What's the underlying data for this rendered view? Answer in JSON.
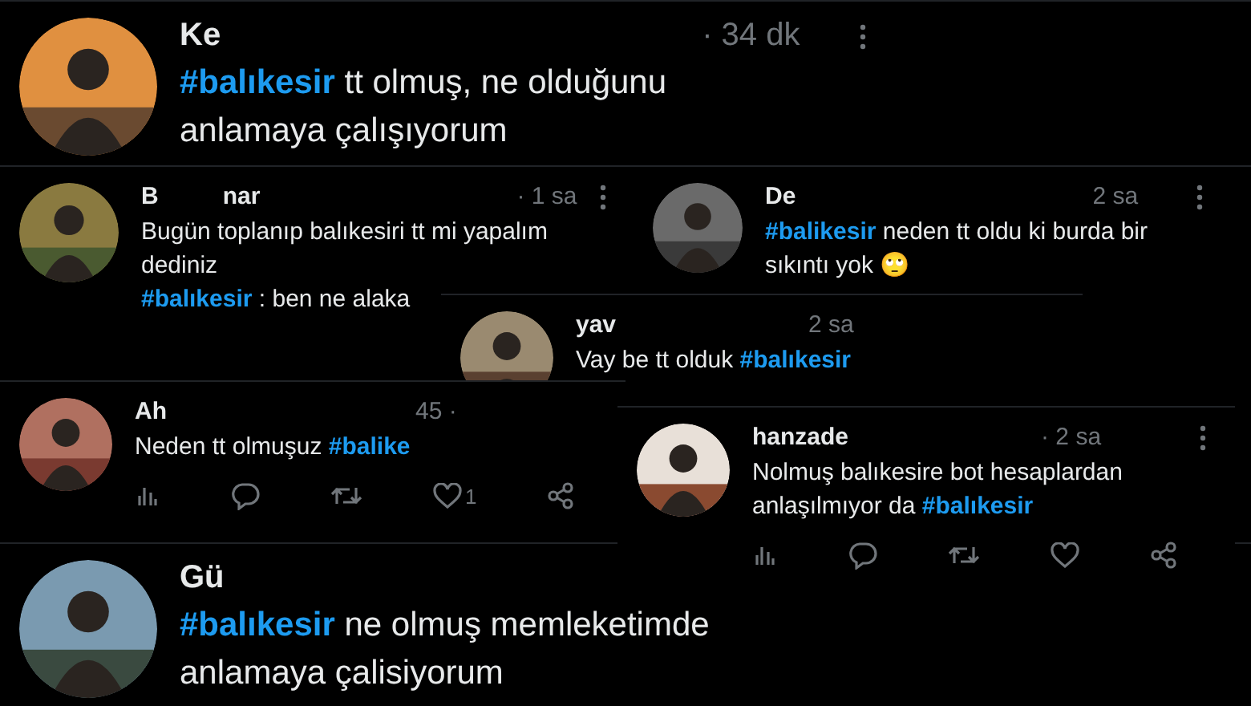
{
  "tweets": [
    {
      "name": "Ke",
      "time": "· 34 dk",
      "text": [
        "**#balıkesir** tt olmuş, ne olduğunu",
        "anlamaya çalışıyorum"
      ]
    },
    {
      "name": "B",
      "name_tail": "nar",
      "time": "· 1 sa",
      "text": [
        "Bugün toplanıp balıkesiri tt mi yapalım",
        "dediniz",
        "**#balıkesir** : ben ne alaka"
      ]
    },
    {
      "name": "De",
      "time": "2 sa",
      "text": [
        "**#balikesir** neden tt oldu ki burda bir",
        "sıkıntı yok 🙄"
      ]
    },
    {
      "name": "yav",
      "time": "2 sa",
      "text": [
        "Vay be tt olduk **#balıkesir**"
      ]
    },
    {
      "name": "Ah",
      "time": "45 ·",
      "text": [
        "Neden tt olmuşuz **#balike**"
      ],
      "actions": [
        {
          "kind": "views"
        },
        {
          "kind": "reply"
        },
        {
          "kind": "retweet"
        },
        {
          "kind": "like",
          "count": "1"
        },
        {
          "kind": "share"
        }
      ]
    },
    {
      "name": "hanzade",
      "time": "· 2 sa",
      "text": [
        "Nolmuş balıkesire bot hesaplardan",
        "anlaşılmıyor da **#balıkesir**"
      ],
      "actions": [
        {
          "kind": "views"
        },
        {
          "kind": "reply"
        },
        {
          "kind": "retweet"
        },
        {
          "kind": "like"
        },
        {
          "kind": "share"
        }
      ]
    },
    {
      "name": "Gü",
      "text": [
        "**#balıkesir** ne olmuş memleketimde",
        "anlamaya çalisiyorum"
      ]
    }
  ]
}
